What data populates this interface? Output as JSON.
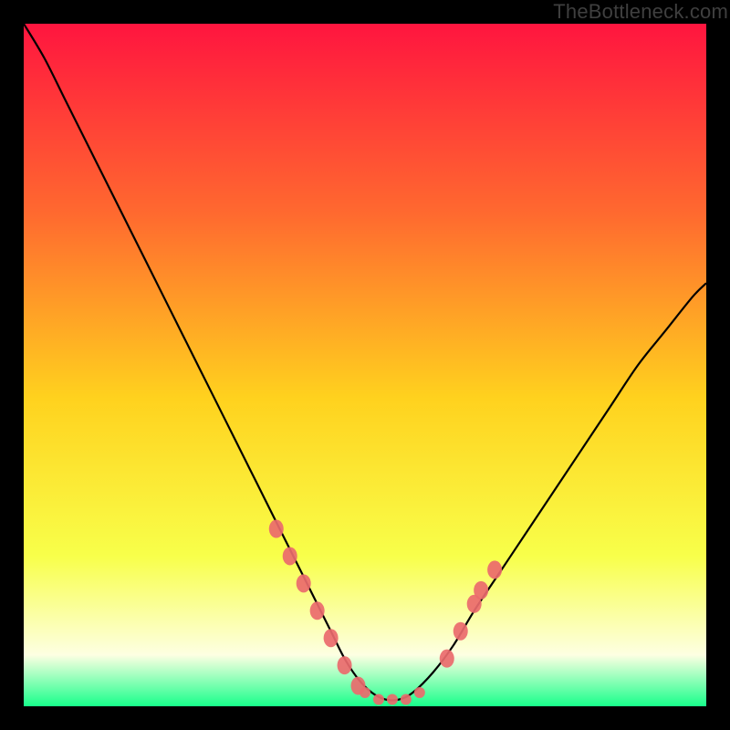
{
  "watermark": "TheBottleneck.com",
  "colors": {
    "frame_bg": "#000000",
    "grad_top": "#ff153f",
    "grad_mid1": "#ff6a2f",
    "grad_mid2": "#ffd21e",
    "grad_mid3": "#f8ff4a",
    "grad_low": "#fdffe2",
    "grad_bottom": "#18ff8b",
    "curve": "#000000",
    "marker_fill": "#ea6a6d",
    "marker_stroke": "#c24d50"
  },
  "chart_data": {
    "type": "line",
    "title": "",
    "xlabel": "",
    "ylabel": "",
    "xlim": [
      0,
      100
    ],
    "ylim": [
      0,
      100
    ],
    "series": [
      {
        "name": "bottleneck-curve",
        "x": [
          0,
          3,
          6,
          9,
          12,
          15,
          18,
          21,
          24,
          27,
          30,
          33,
          36,
          39,
          42,
          45,
          47,
          49,
          51,
          53,
          55,
          57,
          60,
          63,
          66,
          70,
          74,
          78,
          82,
          86,
          90,
          94,
          98,
          100
        ],
        "y": [
          100,
          95,
          89,
          83,
          77,
          71,
          65,
          59,
          53,
          47,
          41,
          35,
          29,
          23,
          17,
          11,
          7,
          4,
          2,
          1,
          1,
          2,
          5,
          9,
          14,
          20,
          26,
          32,
          38,
          44,
          50,
          55,
          60,
          62
        ]
      }
    ],
    "markers": {
      "name": "highlighted-points",
      "x": [
        37,
        39,
        41,
        43,
        45,
        47,
        49,
        50,
        52,
        54,
        56,
        58,
        62,
        64,
        66,
        67,
        69
      ],
      "y": [
        26,
        22,
        18,
        14,
        10,
        6,
        3,
        2,
        1,
        1,
        1,
        2,
        7,
        11,
        15,
        17,
        20
      ]
    },
    "gradient_stops": [
      {
        "offset": 0.0,
        "color": "#ff153f"
      },
      {
        "offset": 0.28,
        "color": "#ff6a2f"
      },
      {
        "offset": 0.55,
        "color": "#ffd21e"
      },
      {
        "offset": 0.78,
        "color": "#f8ff4a"
      },
      {
        "offset": 0.925,
        "color": "#fdffe2"
      },
      {
        "offset": 1.0,
        "color": "#18ff8b"
      }
    ]
  }
}
